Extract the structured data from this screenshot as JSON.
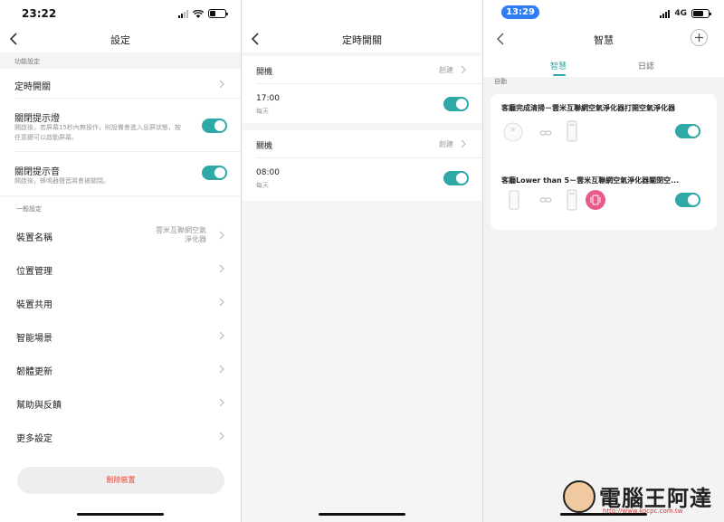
{
  "panel1": {
    "status_time": "23:22",
    "nav_title": "設定",
    "section1_title": "功能設定",
    "timer_label": "定時開關",
    "indicator": {
      "label": "關閉提示燈",
      "desc": "開啟後，若屏幕15秒內無操作，則設備會進入息屏狀態，按任意鍵可以啟動屏幕。",
      "toggle_on": true
    },
    "sound": {
      "label": "關閉提示音",
      "desc": "開啟後，蜂鳴器聲音將會被關閉。",
      "toggle_on": true
    },
    "section2_title": "一般設定",
    "device_name": {
      "label": "裝置名稱",
      "value_line1": "雲米互聯網空氣",
      "value_line2": "淨化器"
    },
    "general_items": [
      "位置管理",
      "裝置共用",
      "智能場景",
      "韌體更新",
      "幫助與反饋",
      "更多設定"
    ],
    "delete_label": "刪除裝置"
  },
  "panel2": {
    "nav_title": "定時開關",
    "groups": [
      {
        "header": "開機",
        "action": "創建",
        "time": "17:00",
        "repeat": "每天",
        "toggle_on": true
      },
      {
        "header": "關機",
        "action": "創建",
        "time": "08:00",
        "repeat": "每天",
        "toggle_on": true
      }
    ]
  },
  "panel3": {
    "status_time": "13:29",
    "network": "4G",
    "nav_title": "智慧",
    "tabs": [
      {
        "label": "智慧",
        "active": true
      },
      {
        "label": "日誌",
        "active": false
      }
    ],
    "section_title": "自動",
    "scenes": [
      {
        "title": "客廳完成清掃－雲米互聯網空氣淨化器打開空氣淨化器",
        "toggle_on": true
      },
      {
        "title": "客廳Lower than 5－雲米互聯網空氣淨化器關閉空...",
        "toggle_on": true
      }
    ]
  },
  "watermark": {
    "text": "電腦王阿達",
    "url": "http://www.kocpc.com.tw"
  },
  "colors": {
    "accent": "#2fa8a8",
    "danger": "#e4483b",
    "status_pill": "#2e7cf6",
    "pink": "#e85a8a"
  }
}
